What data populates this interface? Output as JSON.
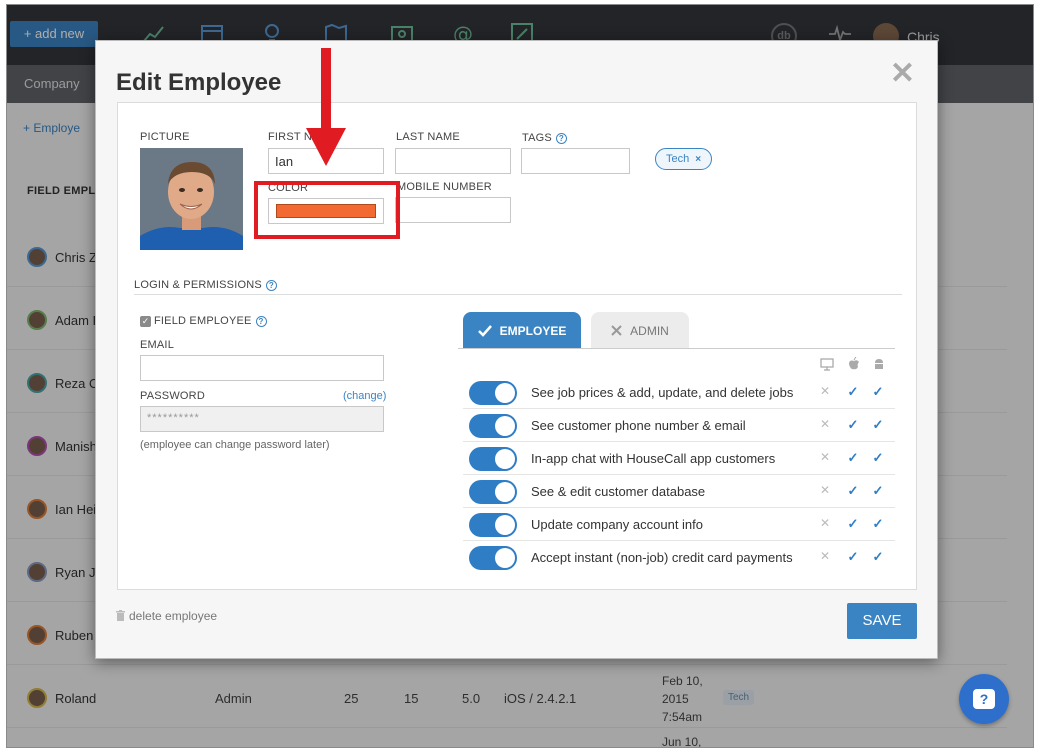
{
  "app": {
    "add_new_label": "+ add new",
    "user_name": "Chris",
    "db_badge": "db",
    "company_tab": "Company",
    "add_employee_link": "+ Employe",
    "field_header": "FIELD EMPLO",
    "employees": [
      {
        "name": "Chris Z",
        "ring": "#5a9ad6"
      },
      {
        "name": "Adam P",
        "ring": "#7fb96d"
      },
      {
        "name": "Reza O",
        "ring": "#4aa5a8"
      },
      {
        "name": "Manish",
        "ring": "#b64fb6"
      },
      {
        "name": "Ian Hei",
        "ring": "#e07f3a"
      },
      {
        "name": "Ryan Jo",
        "ring": "#8a9ac0"
      },
      {
        "name": "Ruben",
        "ring": "#e07f3a"
      },
      {
        "name": "Roland",
        "ring": "#d7b84a",
        "role": "Admin",
        "col1": "25",
        "col2": "15",
        "col3": "5.0",
        "os": "iOS / 2.4.2.1",
        "date": "Feb 10, 2015 7:54am",
        "tag": "Tech"
      }
    ],
    "next_date": "Jun 10,",
    "help_glyph": "?"
  },
  "modal": {
    "title": "Edit Employee",
    "close_glyph": "✕",
    "picture_label": "PICTURE",
    "first_name_label": "FIRST NA",
    "first_name_value": "Ian",
    "last_name_label": "LAST NAME",
    "last_name_value": "",
    "tags_label": "TAGS",
    "tag_chip": "Tech",
    "tag_remove": "×",
    "color_label": "COLOR",
    "color_value": "#f26a32",
    "mobile_label": "MOBILE NUMBER",
    "mobile_value": "",
    "login_section": "LOGIN & PERMISSIONS",
    "field_employee_label": "FIELD EMPLOYEE",
    "field_employee_checked": true,
    "email_label": "EMAIL",
    "email_value": "",
    "password_label": "PASSWORD",
    "password_change": "(change)",
    "password_value": "**********",
    "password_note": "(employee can change password later)",
    "tab_employee": "EMPLOYEE",
    "tab_admin": "ADMIN",
    "permissions": [
      {
        "label": "See job prices & add, update, and delete jobs",
        "enabled": true,
        "web": false,
        "ios": true,
        "android": true
      },
      {
        "label": "See customer phone number & email",
        "enabled": true,
        "web": false,
        "ios": true,
        "android": true
      },
      {
        "label": "In-app chat with HouseCall app customers",
        "enabled": true,
        "web": false,
        "ios": true,
        "android": true
      },
      {
        "label": "See & edit customer database",
        "enabled": true,
        "web": false,
        "ios": true,
        "android": true
      },
      {
        "label": "Update company account info",
        "enabled": true,
        "web": false,
        "ios": true,
        "android": true
      },
      {
        "label": "Accept instant (non-job) credit card payments",
        "enabled": true,
        "web": false,
        "ios": true,
        "android": true
      }
    ],
    "delete_label": "delete employee",
    "save_label": "SAVE"
  },
  "colors": {
    "accent": "#3b84c3",
    "highlight": "#e01b22",
    "swatch": "#f26a32"
  }
}
